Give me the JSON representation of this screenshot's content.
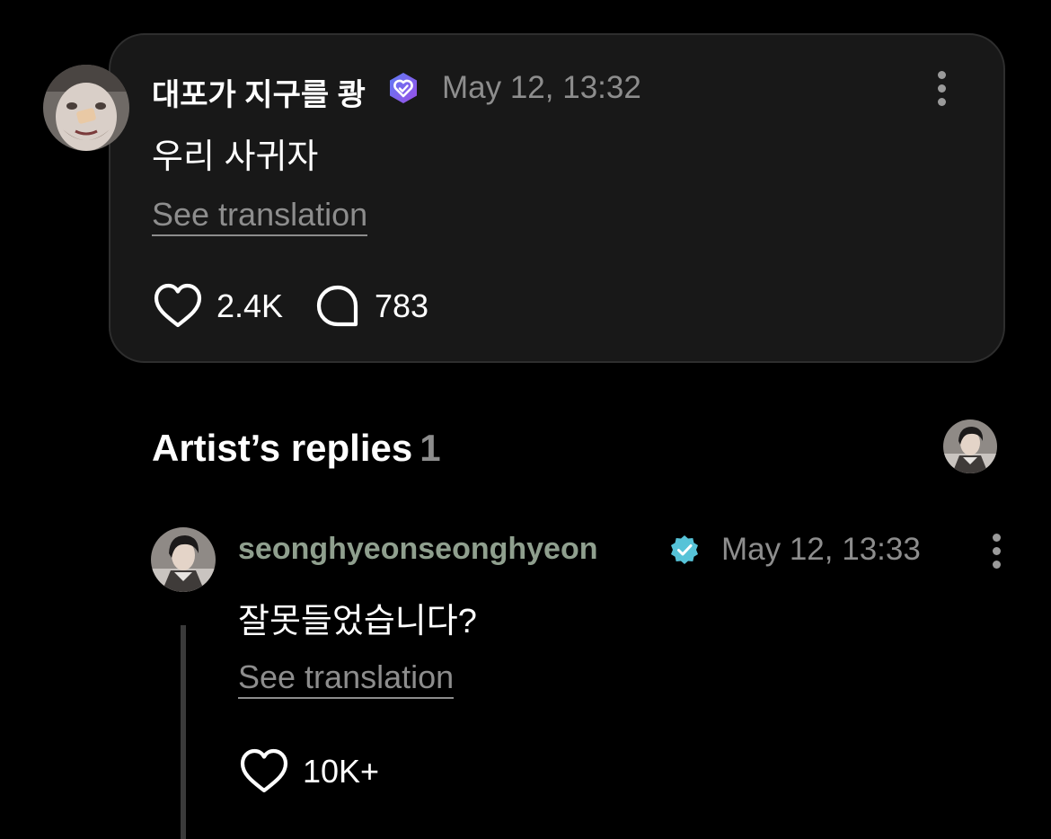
{
  "post": {
    "author": "대포가 지구를 쾅",
    "timestamp": "May 12, 13:32",
    "text": "우리 사귀자",
    "see_translation": "See translation",
    "likes": "2.4K",
    "comments": "783",
    "badge_color": "#7b5cf0",
    "badge_icon": "verified-heart-badge"
  },
  "replies_section": {
    "title": "Artist’s replies",
    "count": "1"
  },
  "reply": {
    "author": "seonghyeonseonghyeon",
    "author_color": "#8f9f8e",
    "timestamp": "May 12, 13:33",
    "text": "잘못들었습니다?",
    "see_translation": "See translation",
    "likes": "10K+",
    "badge_color": "#56c3d8",
    "badge_icon": "verified-check-badge"
  },
  "icons": {
    "like": "heart-outline-icon",
    "comment": "speech-bubble-outline-icon",
    "more": "vertical-ellipsis-icon"
  }
}
